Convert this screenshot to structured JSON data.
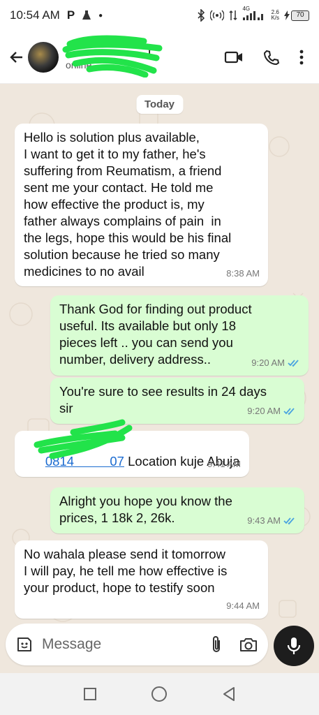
{
  "status_bar": {
    "time": "10:54 AM",
    "net_speed_value": "2.6",
    "net_speed_unit": "K/s",
    "network_type": "4G",
    "battery": "70"
  },
  "header": {
    "contact_name": "r",
    "contact_status": "online"
  },
  "chat": {
    "date_chip": "Today",
    "messages": [
      {
        "direction": "incoming",
        "text": "Hello is solution plus available,\nI want to get it to my father, he's\nsuffering from Reumatism, a friend\nsent me your contact. He told me\nhow effective the product is, my\nfather always complains of pain  in\nthe legs, hope this would be his final\nsolution because he tried so many\nmedicines to no avail",
        "time": "8:38 AM"
      },
      {
        "direction": "outgoing",
        "text": "Thank God for finding out product\nuseful. Its available but only 18\npieces left .. you can send you\nnumber, delivery address..",
        "time": "9:20 AM",
        "read": true
      },
      {
        "direction": "outgoing",
        "text": "You're sure to see results in 24 days\nsir",
        "time": "9:20 AM",
        "read": true
      },
      {
        "direction": "incoming",
        "link_text": "0814          07",
        "text": " Location kuje Abuja",
        "time": "9:41 AM"
      },
      {
        "direction": "outgoing",
        "text": "Alright you hope you know the\nprices, 1 18k 2, 26k.",
        "time": "9:43 AM",
        "read": true
      },
      {
        "direction": "incoming",
        "text": "No wahala please send it tomorrow\nI will pay, he tell me how effective is\nyour product, hope to testify soon",
        "time": "9:44 AM"
      }
    ]
  },
  "composer": {
    "placeholder": "Message"
  },
  "colors": {
    "chat_bg": "#efe7dd",
    "outgoing_bubble": "#d9fdd3",
    "incoming_bubble": "#ffffff",
    "read_ticks": "#4aa3e0",
    "link": "#1b6bd0",
    "scribble": "#22e34a"
  },
  "icons": {
    "back": "arrow-left-icon",
    "video": "video-call-icon",
    "call": "phone-icon",
    "more": "more-vertical-icon",
    "sticker": "sticker-icon",
    "attach": "paperclip-icon",
    "camera": "camera-icon",
    "mic": "microphone-icon"
  }
}
